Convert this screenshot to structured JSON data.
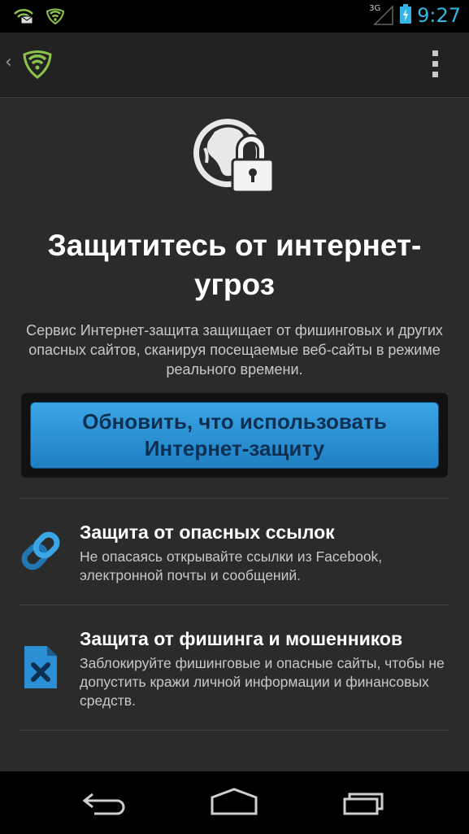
{
  "status_bar": {
    "network_type": "3G",
    "time": "9:27",
    "notification_icons": [
      "mail-icon",
      "shield-wifi-icon"
    ]
  },
  "action_bar": {
    "app_icon": "shield-wifi-icon",
    "menu_icon": "overflow-menu-icon"
  },
  "hero": {
    "icon": "globe-lock-icon",
    "title": "Защититесь от интернет-угроз",
    "subtitle": "Сервис Интернет-защита защищает от фишинговых и других опасных сайтов, сканируя посещаемые веб-сайты в режиме реального времени."
  },
  "upgrade_button": {
    "label": "Обновить, что использовать Интернет-защиту"
  },
  "features": [
    {
      "icon": "link-icon",
      "title": "Защита от опасных ссылок",
      "description": "Не опасаясь открывайте ссылки из Facebook, электронной почты и сообщений."
    },
    {
      "icon": "blocked-file-icon",
      "title": "Защита от фишинга и мошенников",
      "description": "Заблокируйте фишинговые и опасные сайты, чтобы не допустить кражи личной информации и финансовых средств."
    }
  ],
  "nav_bar": {
    "buttons": [
      "back-icon",
      "home-icon",
      "recent-apps-icon"
    ]
  },
  "colors": {
    "accent": "#33b5e5",
    "button": "#2a8fd4",
    "shield_green": "#8bc34a"
  }
}
